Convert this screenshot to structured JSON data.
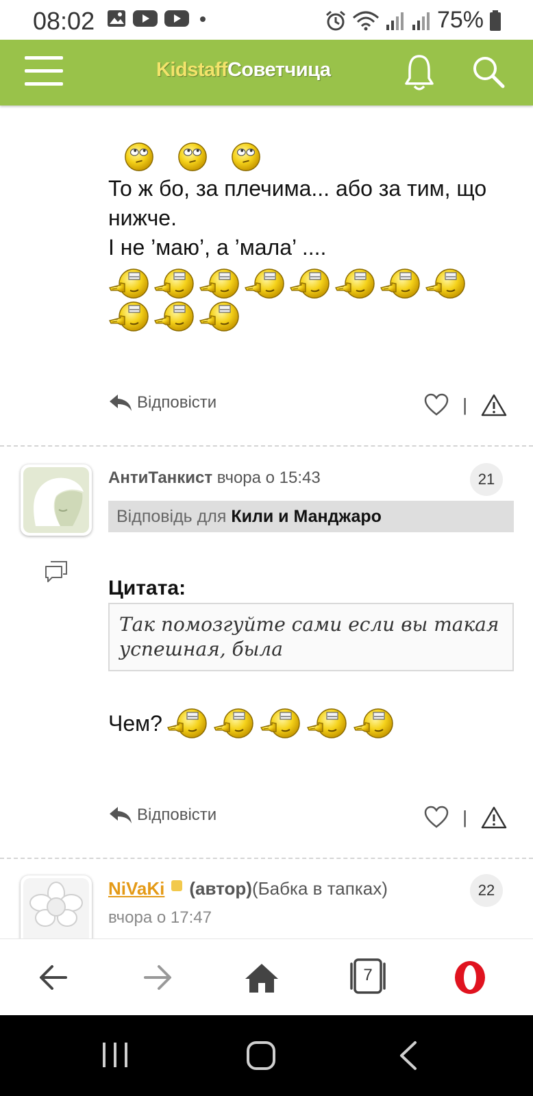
{
  "status_bar": {
    "time": "08:02",
    "battery": "75%"
  },
  "header": {
    "brand_part1": "Kidstaff",
    "brand_part2": "Советчица"
  },
  "post1": {
    "line1": "То ж бо, за плечима... або за тим, що нижче.",
    "line2": "І не ’маю’, а ’мала’ ....",
    "reply_label": "Відповісти"
  },
  "comment21": {
    "author": "АнтиТанкист",
    "time": "вчора о 15:43",
    "number": "21",
    "reply_to_prefix": "Відповідь для",
    "reply_to_name": "Кили и Манджаро",
    "quote_title": "Цитата:",
    "quote_text": "Так помозгуйте сами если вы такая успешная, была",
    "body": "Чем?",
    "reply_label": "Відповісти"
  },
  "comment22": {
    "author": "NiVaKi",
    "role": "(автор)",
    "status": "(Бабка в тапках)",
    "number": "22",
    "time_cut": "вчора о 17:47"
  },
  "browser_nav": {
    "tabs_count": "7"
  },
  "colors": {
    "header_green": "#99c24a",
    "brand_yellow": "#f3e36b",
    "nick_orange": "#e49a17",
    "opera_red": "#e0131f"
  },
  "icons": [
    "hamburger-icon",
    "bell-icon",
    "search-icon",
    "reply-icon",
    "heart-icon",
    "warning-icon",
    "comments-icon",
    "back-icon",
    "forward-icon",
    "home-icon",
    "tabs-icon",
    "opera-icon",
    "recents-icon",
    "android-home-icon",
    "android-back-icon"
  ]
}
